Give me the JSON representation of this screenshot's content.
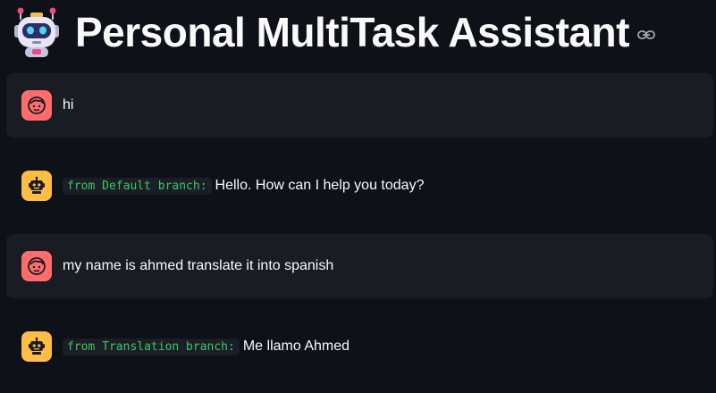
{
  "header": {
    "title": "Personal MultiTask Assistant",
    "robot_icon": "robot-face-icon",
    "link_icon": "link-icon"
  },
  "colors": {
    "background": "#0e1117",
    "user_bubble": "#1a1c24",
    "user_avatar": "#ff6c6c",
    "bot_avatar": "#ffbd45",
    "badge_text": "#3cc863"
  },
  "messages": [
    {
      "role": "user",
      "avatar_icon": "user-face-icon",
      "text": "hi"
    },
    {
      "role": "assistant",
      "avatar_icon": "robot-icon",
      "branch": "from Default branch:",
      "text": "Hello. How can I help you today?"
    },
    {
      "role": "user",
      "avatar_icon": "user-face-icon",
      "text": "my name is ahmed translate it into spanish"
    },
    {
      "role": "assistant",
      "avatar_icon": "robot-icon",
      "branch": "from Translation branch:",
      "text": "Me llamo Ahmed"
    }
  ]
}
